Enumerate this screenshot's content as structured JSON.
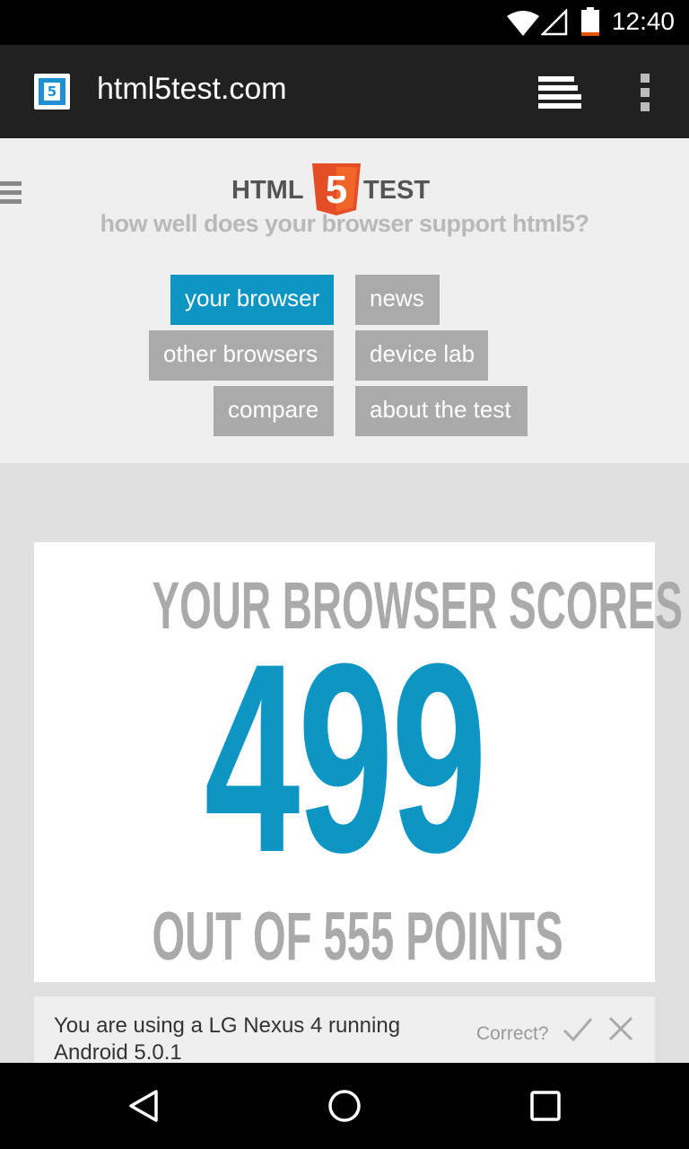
{
  "status_bar": {
    "time": "12:40",
    "icons": [
      "wifi-icon",
      "signal-icon",
      "battery-icon"
    ],
    "battery_low_color": "#e65100"
  },
  "toolbar": {
    "url": "html5test.com",
    "favicon": "html5-favicon",
    "icons": [
      "tabs-icon",
      "overflow-menu-icon"
    ]
  },
  "site": {
    "logo_left": "HTML",
    "logo_badge": "5",
    "logo_right": "TEST",
    "tagline": "how well does your browser support html5?",
    "nav": [
      {
        "label": "your browser",
        "active": true
      },
      {
        "label": "news",
        "active": false
      },
      {
        "label": "other browsers",
        "active": false
      },
      {
        "label": "device lab",
        "active": false
      },
      {
        "label": "compare",
        "active": false
      },
      {
        "label": "about the test",
        "active": false
      }
    ]
  },
  "score": {
    "heading": "YOUR BROWSER SCORES",
    "value": "499",
    "footer": "OUT OF 555 POINTS"
  },
  "device": {
    "text": "You are using a LG Nexus 4 running Android 5.0.1",
    "correct_label": "Correct?"
  },
  "colors": {
    "accent": "#0d95c4",
    "html5_orange": "#e44d26",
    "button_gray": "#aaaaaa"
  },
  "nav_bar": {
    "icons": [
      "back-icon",
      "home-icon",
      "recents-icon"
    ]
  }
}
